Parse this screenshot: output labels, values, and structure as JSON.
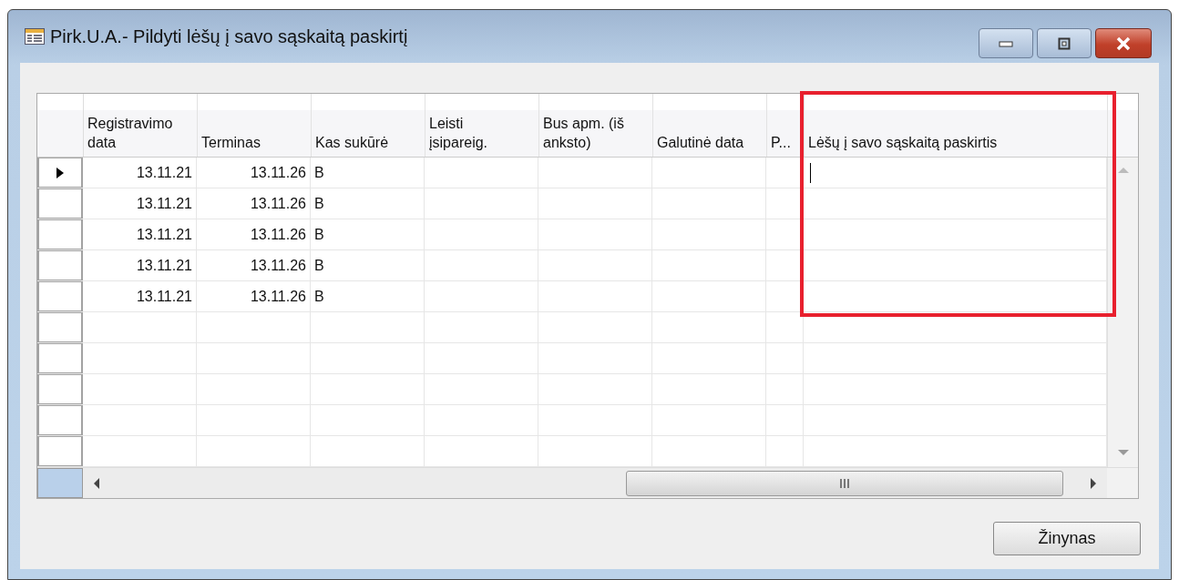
{
  "window": {
    "title": "Pirk.U.A.- Pildyti lėšų į savo sąskaitą paskirtį"
  },
  "table": {
    "columns": [
      "Registravimo data",
      "Terminas",
      "Kas sukūrė",
      "Leisti įsipareig.",
      "Bus apm. (iš anksto)",
      "Galutinė data",
      "P...",
      "Lėšų į savo sąskaitą paskirtis"
    ],
    "rows": [
      {
        "selected": true,
        "cells": [
          "13.11.21",
          "13.11.26",
          "B"
        ]
      },
      {
        "selected": false,
        "cells": [
          "13.11.21",
          "13.11.26",
          "B"
        ]
      },
      {
        "selected": false,
        "cells": [
          "13.11.21",
          "13.11.26",
          "B"
        ]
      },
      {
        "selected": false,
        "cells": [
          "13.11.21",
          "13.11.26",
          "B"
        ]
      },
      {
        "selected": false,
        "cells": [
          "13.11.21",
          "13.11.26",
          "B"
        ]
      }
    ]
  },
  "buttons": [
    "Žinynas"
  ]
}
